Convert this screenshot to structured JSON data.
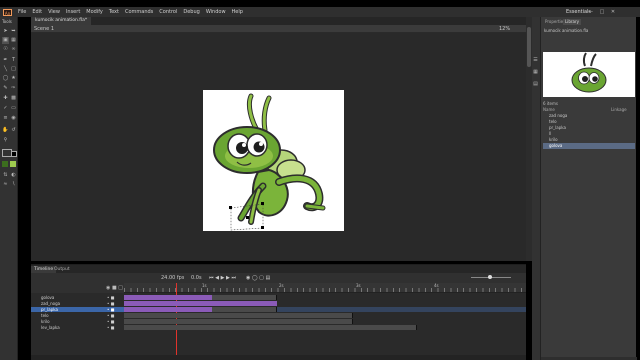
{
  "menubar": {
    "logo": "An",
    "items": [
      "File",
      "Edit",
      "View",
      "Insert",
      "Modify",
      "Text",
      "Commands",
      "Control",
      "Debug",
      "Window",
      "Help"
    ],
    "workspace": "Essentials"
  },
  "tools_panel": {
    "title": "Tools"
  },
  "document": {
    "tab_label": "kumocik animation.fla*",
    "scene_label": "Scene 1",
    "zoom": "12%"
  },
  "library_panel": {
    "tabs": [
      "Properties",
      "Library"
    ],
    "file": "kumocik animation.fla",
    "item_count": "6 items",
    "column_header": "Name",
    "column_header_right": "Linkage",
    "items": [
      {
        "label": "zad noga",
        "selected": false
      },
      {
        "label": "telo",
        "selected": false
      },
      {
        "label": "pr_lapka",
        "selected": false
      },
      {
        "label": "ll",
        "selected": false
      },
      {
        "label": "krilo",
        "selected": false
      },
      {
        "label": "golova",
        "selected": true
      }
    ]
  },
  "timeline": {
    "tabs": [
      "Timeline",
      "Output"
    ],
    "fps": "24.00 fps",
    "time": "0.0s",
    "ruler_ticks": [
      "1s",
      "2s",
      "3s",
      "4s"
    ],
    "layers": [
      {
        "name": "golova",
        "selected": false,
        "tween_end": 0.22,
        "frames_end": 0.38
      },
      {
        "name": "zad_noga",
        "selected": false,
        "tween_end": 0.38,
        "frames_end": 0.38
      },
      {
        "name": "pr_lapka",
        "selected": true,
        "tween_end": 0.22,
        "frames_end": 0.38
      },
      {
        "name": "telo",
        "selected": false,
        "tween_end": 0,
        "frames_end": 0.57
      },
      {
        "name": "krilo",
        "selected": false,
        "tween_end": 0,
        "frames_end": 0.57
      },
      {
        "name": "lev_lapka",
        "selected": false,
        "tween_end": 0,
        "frames_end": 0.73
      }
    ],
    "playhead_fraction": 0.13
  },
  "colors": {
    "accent": "#3b66a8",
    "tween": "#8b5bb8",
    "playhead": "#e0332c",
    "grasshopper_light": "#9ecb4f",
    "grasshopper_dark": "#3c6e1e"
  }
}
